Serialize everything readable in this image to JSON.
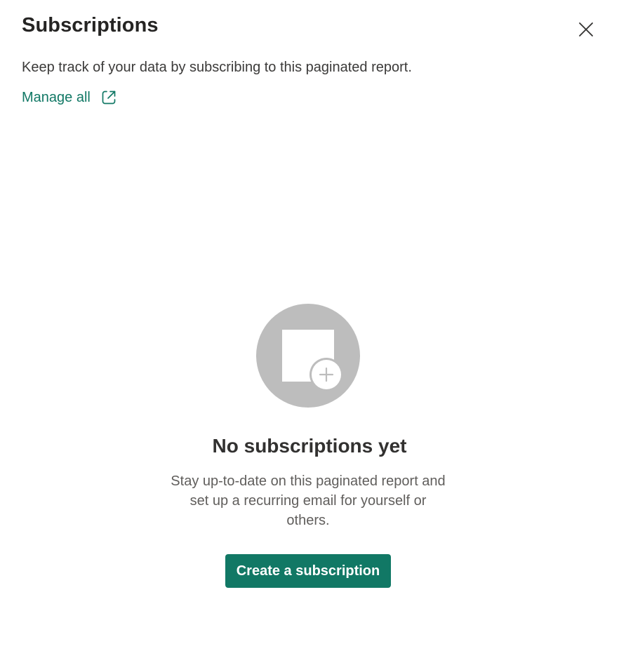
{
  "panel": {
    "title": "Subscriptions",
    "description": "Keep track of your data by subscribing to this paginated report.",
    "manage_link": {
      "label": "Manage all",
      "icon": "open-in-new-window-icon"
    },
    "close_icon": "close-icon"
  },
  "empty_state": {
    "illustration": "empty-subscription-icon",
    "title": "No subscriptions yet",
    "text": "Stay up-to-date on this paginated report and set up a recurring email for yourself or others.",
    "button_label": "Create a subscription"
  },
  "colors": {
    "accent": "#117865",
    "illustration_gray": "#bdbdbd",
    "title_text": "#252423",
    "body_text": "#3b3a39",
    "secondary_text": "#605e5c"
  }
}
